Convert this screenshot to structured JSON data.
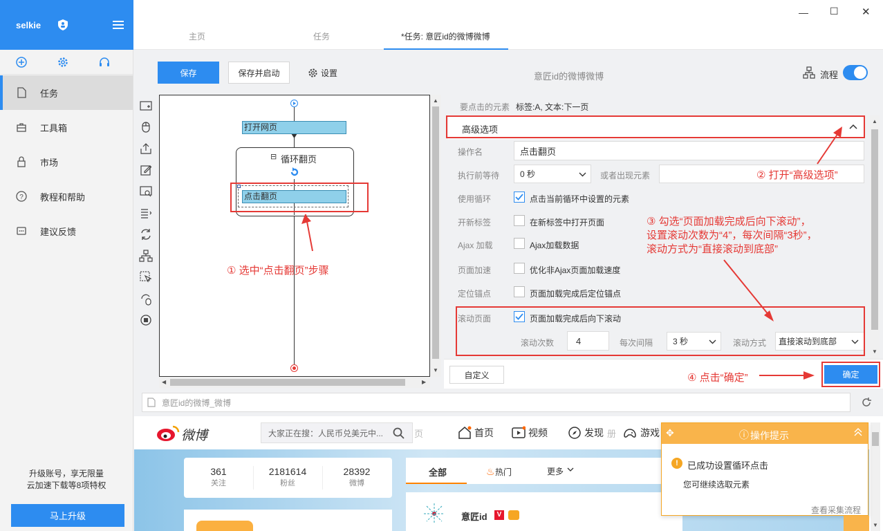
{
  "app": {
    "brand": "selkie",
    "window_controls": {
      "min": "—",
      "max": "☐",
      "close": "✕"
    }
  },
  "sidebar": {
    "items": [
      {
        "label": "任务",
        "icon": "file-icon"
      },
      {
        "label": "工具箱",
        "icon": "toolbox-icon"
      },
      {
        "label": "市场",
        "icon": "lock-icon"
      },
      {
        "label": "教程和帮助",
        "icon": "help-icon"
      },
      {
        "label": "建议反馈",
        "icon": "chat-icon"
      }
    ],
    "upgrade_text_1": "升级账号，享无限量",
    "upgrade_text_2": "云加速下载等8项特权",
    "upgrade_button": "马上升级"
  },
  "tabs": [
    "主页",
    "任务",
    "*任务: 意匠id的微博微博"
  ],
  "toolbar": {
    "save": "保存",
    "save_start": "保存并启动",
    "settings": "设置",
    "task_title": "意匠id的微博微博",
    "flow_label": "流程"
  },
  "workflow": {
    "open_page": "打开网页",
    "loop": "循环翻页",
    "loop_toggle": "⊟",
    "click": "点击翻页",
    "step1": "① 选中“点击翻页”步骤"
  },
  "props": {
    "element_label": "要点击的元素",
    "element_value": "标签:A, 文本:下一页",
    "advanced": "高级选项",
    "op_name_label": "操作名",
    "op_name_value": "点击翻页",
    "wait_label": "执行前等待",
    "wait_value": "0 秒",
    "or_appear": "或者出现元素",
    "loop_label": "使用循环",
    "loop_cb": "点击当前循环中设置的元素",
    "newtab_label": "开新标签",
    "newtab_cb": "在新标签中打开页面",
    "ajax_label": "Ajax 加载",
    "ajax_cb": "Ajax加载数据",
    "speed_label": "页面加速",
    "speed_cb": "优化非Ajax页面加载速度",
    "anchor_label": "定位锚点",
    "anchor_cb": "页面加载完成后定位锚点",
    "scroll_label": "滚动页面",
    "scroll_cb": "页面加载完成后向下滚动",
    "scroll_count_label": "滚动次数",
    "scroll_count": "4",
    "interval_label": "每次间隔",
    "interval_value": "3 秒",
    "scroll_mode_label": "滚动方式",
    "scroll_mode_value": "直接滚动到底部",
    "custom": "自定义",
    "ok": "确定",
    "step2": "② 打开“高级选项”",
    "step3_l1": "③ 勾选“页面加载完成后向下滚动”，",
    "step3_l2": "设置滚动次数为“4”，每次间隔“3秒”，",
    "step3_l3": "滚动方式为“直接滚动到底部”",
    "step4": "④ 点击“确定”"
  },
  "browser": {
    "url": "意匠id的微博_微博",
    "logo": "微博",
    "search_placeholder": "大家正在搜：人民币兑美元中...",
    "partial": "页",
    "nav": [
      {
        "label": "首页",
        "icon": "home-icon"
      },
      {
        "label": "视频",
        "icon": "video-icon"
      },
      {
        "label": "发现",
        "icon": "compass-icon"
      },
      {
        "label": "游戏",
        "icon": "game-icon"
      }
    ],
    "nav_partial": "册",
    "stats": [
      {
        "num": "361",
        "label": "关注"
      },
      {
        "num": "2181614",
        "label": "粉丝"
      },
      {
        "num": "28392",
        "label": "微博"
      }
    ],
    "feed_tabs": {
      "all": "全部",
      "hot": "热门",
      "more": "更多"
    },
    "user": "意匠id"
  },
  "tip": {
    "title": "操作提示",
    "msg": "已成功设置循环点击",
    "sub": "您可继续选取元素",
    "link": "查看采集流程"
  }
}
